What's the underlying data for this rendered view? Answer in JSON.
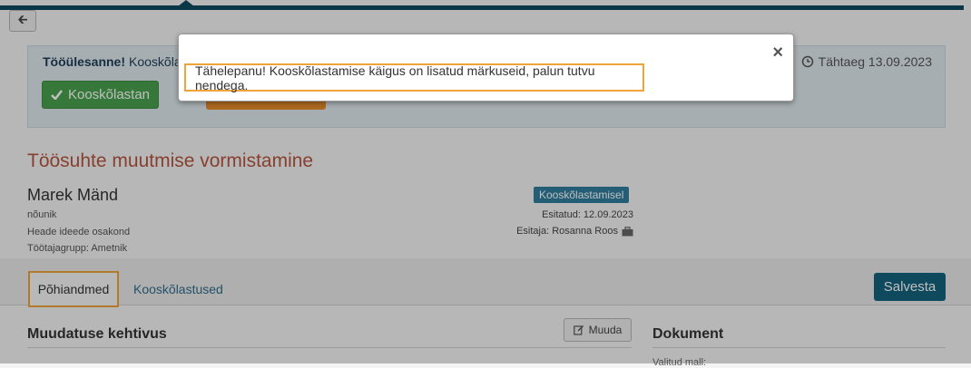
{
  "task": {
    "label": "Tööülesanne!",
    "label_rest": "Kooskõlas",
    "approve_label": "Kooskõlastan",
    "deadline": "Tähtaeg 13.09.2023"
  },
  "page": {
    "title": "Töösuhte muutmise vormistamine"
  },
  "employee": {
    "name": "Marek Mänd",
    "position": "nõunik",
    "department": "Heade ideede osakond",
    "group": "Töötajagrupp: Ametnik"
  },
  "document_meta": {
    "status": "Kooskõlastamisel",
    "submitted": "Esitatud: 12.09.2023",
    "submitter": "Esitaja: Rosanna Roos"
  },
  "tabs": [
    {
      "label": "Põhiandmed"
    },
    {
      "label": "Kooskõlastused"
    }
  ],
  "actions": {
    "save_label": "Salvesta",
    "edit_label": "Muuda"
  },
  "sections": {
    "change_validity": "Muudatuse kehtivus",
    "document": "Dokument",
    "document_peek": "Valitud mall:"
  },
  "modal": {
    "message": "Tähelepanu! Kooskõlastamise käigus on lisatud märkuseid, palun tutvu nendega.",
    "close_symbol": "×"
  },
  "colors": {
    "accent": "#0d4a5f",
    "title": "#b5553f",
    "approve": "#48a14d",
    "highlight": "#f0a33a",
    "badge": "#2f7d9e"
  }
}
